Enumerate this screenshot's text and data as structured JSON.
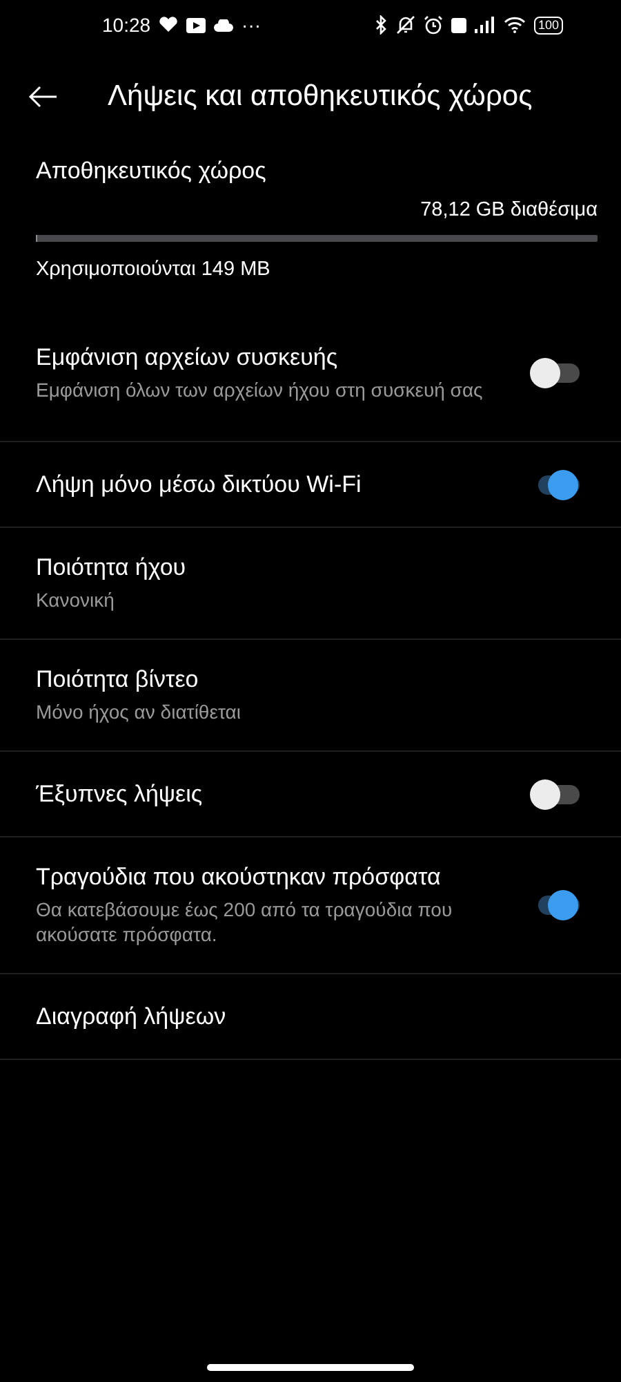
{
  "status_bar": {
    "time": "10:28",
    "more": "···",
    "battery": "100"
  },
  "header": {
    "title": "Λήψεις και αποθηκευτικός χώρος"
  },
  "storage": {
    "title": "Αποθηκευτικός χώρος",
    "available": "78,12 GB διαθέσιμα",
    "level": 0.002,
    "used": "Χρησιμοποιούνται 149 MB"
  },
  "settings": [
    {
      "kind": "toggle",
      "title": "Εμφάνιση αρχείων συσκευής",
      "subtitle": "Εμφάνιση όλων των αρχείων ήχου στη συσκευή σας",
      "on": false
    },
    {
      "kind": "toggle",
      "title": "Λήψη μόνο μέσω δικτύου Wi-Fi",
      "on": true
    },
    {
      "kind": "link",
      "title": "Ποιότητα ήχου",
      "subtitle": "Κανονική"
    },
    {
      "kind": "link",
      "title": "Ποιότητα βίντεο",
      "subtitle": "Μόνο ήχος αν διατίθεται"
    },
    {
      "kind": "toggle",
      "title": "Έξυπνες λήψεις",
      "on": false
    },
    {
      "kind": "toggle",
      "title": "Τραγούδια που ακούστηκαν πρόσφατα",
      "subtitle": "Θα κατεβάσουμε έως 200 από τα τραγούδια που ακούσατε πρόσφατα.",
      "on": true
    },
    {
      "kind": "link",
      "title": "Διαγραφή λήψεων"
    }
  ]
}
